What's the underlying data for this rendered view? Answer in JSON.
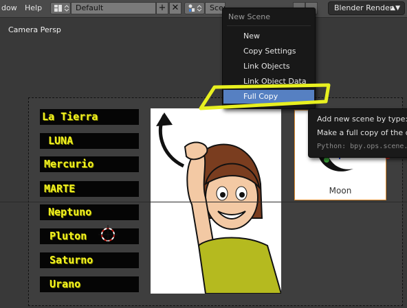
{
  "header": {
    "menu_items": [
      "dow",
      "Help"
    ],
    "layout_value": "Default",
    "add_symbol": "+",
    "remove_symbol": "✕",
    "scene_value": "Scen",
    "render_engine": "Blender Render"
  },
  "viewport": {
    "label": "Camera Persp"
  },
  "planets": [
    "La Tierra",
    "LUNA",
    "Mercurio",
    "MARTE",
    "Neptuno",
    "Pluton",
    "Saturno",
    "Urano"
  ],
  "moon_card": {
    "label": "Moon"
  },
  "scene_menu": {
    "title": "New Scene",
    "items": [
      "New",
      "Copy Settings",
      "Link Objects",
      "Link Object Data",
      "Full Copy"
    ],
    "active_index": 4
  },
  "tooltip": {
    "title": "Add new scene by type:",
    "title_suffix": "F",
    "description": "Make a full copy of the cur",
    "python": "Python: bpy.ops.scene."
  },
  "colors": {
    "highlight": "#e8f020",
    "active_item": "#5680c2",
    "label_text": "#f0f020"
  }
}
